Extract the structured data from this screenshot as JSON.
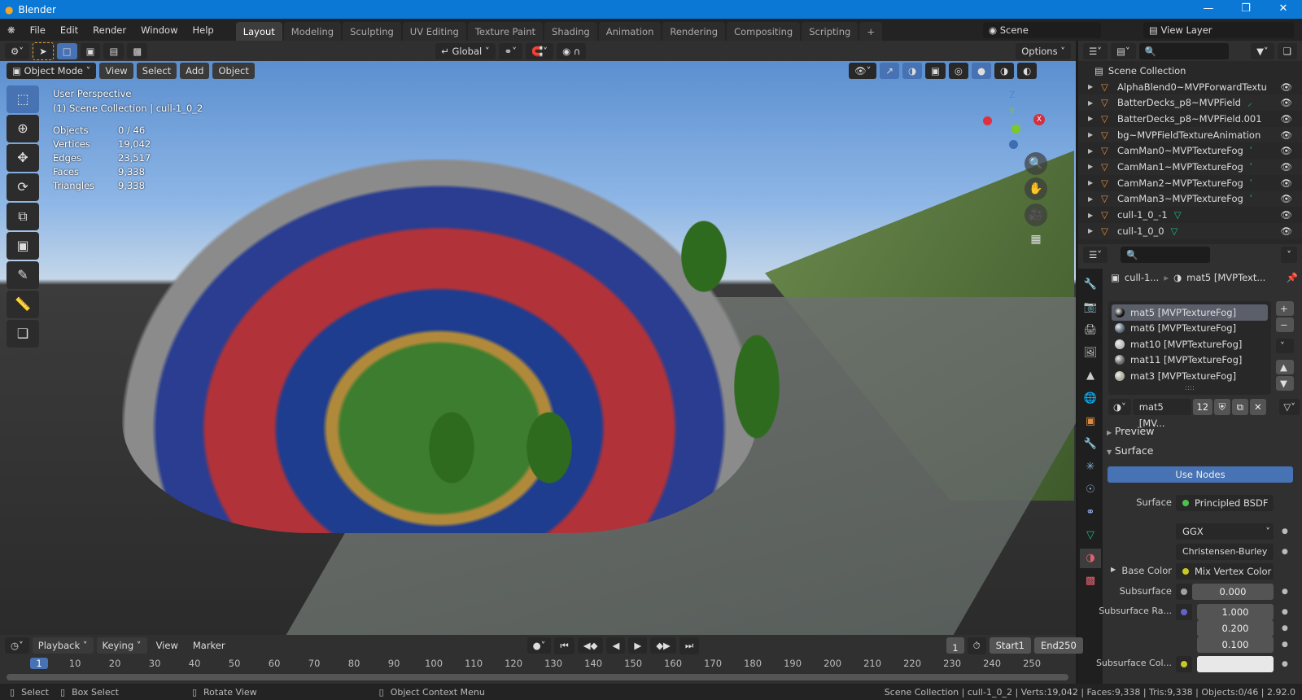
{
  "window": {
    "title": "Blender",
    "minimize": "—",
    "maximize": "❐",
    "close": "✕"
  },
  "menu": [
    "File",
    "Edit",
    "Render",
    "Window",
    "Help"
  ],
  "workspaces": [
    "Layout",
    "Modeling",
    "Sculpting",
    "UV Editing",
    "Texture Paint",
    "Shading",
    "Animation",
    "Rendering",
    "Compositing",
    "Scripting"
  ],
  "active_workspace": "Layout",
  "add_workspace": "+",
  "scene": {
    "name": "Scene",
    "view_layer": "View Layer"
  },
  "tool_header": {
    "transform_orientation": "Global",
    "options": "Options"
  },
  "viewport_header": {
    "mode": "Object Mode",
    "menus": [
      "View",
      "Select",
      "Add",
      "Object"
    ]
  },
  "viewport": {
    "perspective": "User Perspective",
    "collection": "(1) Scene Collection | cull-1_0_2",
    "stats": [
      {
        "label": "Objects",
        "value": "0 / 46"
      },
      {
        "label": "Vertices",
        "value": "19,042"
      },
      {
        "label": "Edges",
        "value": "23,517"
      },
      {
        "label": "Faces",
        "value": "9,338"
      },
      {
        "label": "Triangles",
        "value": "9,338"
      }
    ],
    "gizmo": {
      "z": "Z",
      "y": "Y",
      "x": "X"
    }
  },
  "outliner": {
    "root": "Scene Collection",
    "items": [
      {
        "name": "AlphaBlend0~MVPForwardTextu"
      },
      {
        "name": "BatterDecks_p8~MVPField"
      },
      {
        "name": "BatterDecks_p8~MVPField.001"
      },
      {
        "name": "bg~MVPFieldTextureAnimation"
      },
      {
        "name": "CamMan0~MVPTextureFog"
      },
      {
        "name": "CamMan1~MVPTextureFog"
      },
      {
        "name": "CamMan2~MVPTextureFog"
      },
      {
        "name": "CamMan3~MVPTextureFog"
      },
      {
        "name": "cull-1_0_-1"
      },
      {
        "name": "cull-1_0_0"
      }
    ]
  },
  "properties": {
    "breadcrumb": {
      "object": "cull-1...",
      "material": "mat5 [MVPText..."
    },
    "slots": [
      "mat5 [MVPTextureFog]",
      "mat6 [MVPTextureFog]",
      "mat10 [MVPTextureFog]",
      "mat11 [MVPTextureFog]",
      "mat3 [MVPTextureFog]"
    ],
    "active_slot": 0,
    "material_name": "mat5 [MV...",
    "users": "12",
    "panels": {
      "preview": "Preview",
      "surface": "Surface"
    },
    "use_nodes": "Use Nodes",
    "surface_label": "Surface",
    "surface_value": "Principled BSDF",
    "distribution": "GGX",
    "subsurface_method": "Christensen-Burley",
    "base_color_label": "Base Color",
    "base_color_value": "Mix Vertex Color",
    "subsurface_label": "Subsurface",
    "subsurface_value": "0.000",
    "subsurface_radius_label": "Subsurface Ra...",
    "subsurface_radius": [
      "1.000",
      "0.200",
      "0.100"
    ],
    "subsurface_color_label": "Subsurface Col...",
    "colors": {
      "surface_socket": "#4fc04f",
      "color_socket": "#c7c729",
      "float_socket": "#a1a1a1",
      "vector_socket": "#6363c7",
      "subsurface_color": "#e8e8e8"
    }
  },
  "timeline": {
    "menus": [
      "Playback",
      "Keying",
      "View",
      "Marker"
    ],
    "current_frame": "1",
    "start_label": "Start",
    "start": "1",
    "end_label": "End",
    "end": "250",
    "ticks": [
      "1",
      "10",
      "20",
      "30",
      "40",
      "50",
      "60",
      "70",
      "80",
      "90",
      "100",
      "110",
      "120",
      "130",
      "140",
      "150",
      "160",
      "170",
      "180",
      "190",
      "200",
      "210",
      "220",
      "230",
      "240",
      "250"
    ]
  },
  "statusbar": {
    "select": "Select",
    "box_select": "Box Select",
    "rotate_view": "Rotate View",
    "context_menu": "Object Context Menu",
    "info": "Scene Collection | cull-1_0_2 | Verts:19,042 | Faces:9,338 | Tris:9,338 | Objects:0/46 | 2.92.0"
  },
  "accent": "#4772b3"
}
